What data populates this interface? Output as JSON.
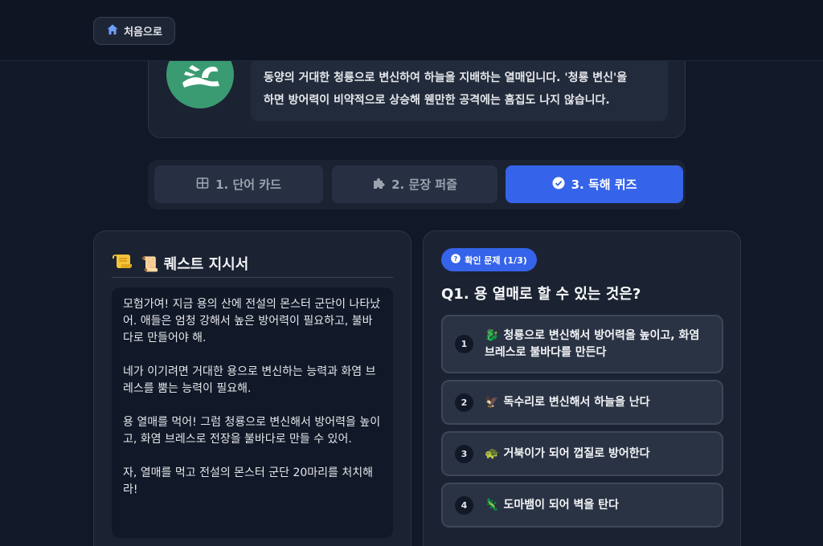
{
  "nav": {
    "home_label": "처음으로",
    "home_icon": "home-icon"
  },
  "monster": {
    "description_line1": "동양의 거대한 청룡으로 변신하여 하늘을 지배하는 열매입니다. '청룡 변신'을",
    "description_line2": "하면 방어력이 비약적으로 상승해 웬만한 공격에는 흠집도 나지 않습니다.",
    "avatar_icon": "dragon-icon"
  },
  "tabs": [
    {
      "num": "1.",
      "label": "단어 카드",
      "icon": "grid-icon"
    },
    {
      "num": "2.",
      "label": "문장 퍼즐",
      "icon": "puzzle-icon"
    },
    {
      "num": "3.",
      "label": "독해 퀴즈",
      "icon": "check-circle-icon",
      "active": true
    }
  ],
  "quest": {
    "title": "📜 퀘스트 지시서",
    "title_icon": "scroll-icon",
    "paragraphs": [
      "모험가여! 지금 용의 산에 전설의 몬스터 군단이 나타났어. 애들은 엄청 강해서 높은 방어력이 필요하고, 불바다로 만들어야 해.",
      "네가 이기려면 거대한 용으로 변신하는 능력과 화염 브레스를 뿜는 능력이 필요해.",
      "용 열매를 먹어! 그럼 청룡으로 변신해서 방어력을 높이고, 화염 브레스로 전장을 불바다로 만들 수 있어.",
      "자, 열매를 먹고 전설의 몬스터 군단 20마리를 처치해라!"
    ]
  },
  "quiz": {
    "badge": "확인 문제 (1/3)",
    "question": "Q1. 용 열매로 할 수 있는 것은?",
    "options": [
      {
        "num": "1",
        "emoji": "🐉",
        "text": "청룡으로 변신해서 방어력을 높이고, 화염 브레스로 불바다를 만든다"
      },
      {
        "num": "2",
        "emoji": "🦅",
        "text": "독수리로 변신해서 하늘을 난다"
      },
      {
        "num": "3",
        "emoji": "🐢",
        "text": "거북이가 되어 껍질로 방어한다"
      },
      {
        "num": "4",
        "emoji": "🦎",
        "text": "도마뱀이 되어 벽을 탄다"
      }
    ]
  },
  "colors": {
    "accent": "#3563e9",
    "background": "#111827",
    "avatar": "#3a9b73"
  }
}
